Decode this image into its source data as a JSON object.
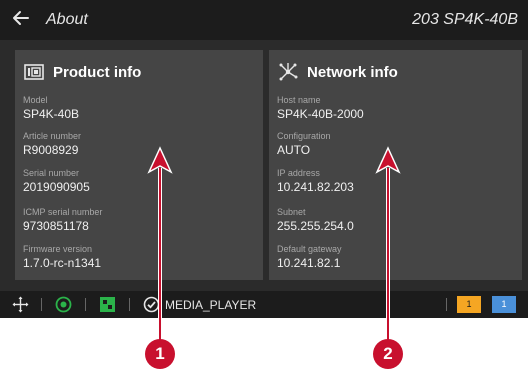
{
  "header": {
    "title": "About",
    "device_id": "203 SP4K-40B"
  },
  "product_info": {
    "title": "Product info",
    "fields": [
      {
        "label": "Model",
        "value": "SP4K-40B"
      },
      {
        "label": "Article number",
        "value": "R9008929"
      },
      {
        "label": "Serial number",
        "value": "2019090905"
      },
      {
        "label": "ICMP serial number",
        "value": "9730851178"
      },
      {
        "label": "Firmware version",
        "value": "1.7.0-rc-n1341"
      }
    ]
  },
  "network_info": {
    "title": "Network info",
    "fields": [
      {
        "label": "Host name",
        "value": "SP4K-40B-2000"
      },
      {
        "label": "Configuration",
        "value": "AUTO"
      },
      {
        "label": "IP address",
        "value": "10.241.82.203"
      },
      {
        "label": "Subnet",
        "value": "255.255.254.0"
      },
      {
        "label": "Default gateway",
        "value": "10.241.82.1"
      }
    ]
  },
  "status_bar": {
    "media_label": "MEDIA_PLAYER",
    "indicator_orange": "1",
    "indicator_blue": "1",
    "icons": [
      "joystick-icon",
      "network-status-icon",
      "grid-icon",
      "media-player-icon"
    ]
  },
  "callouts": {
    "one": "1",
    "two": "2"
  },
  "colors": {
    "callout_red": "#c8102e",
    "indicator_orange": "#f5a623",
    "indicator_blue": "#4a90d9",
    "status_green": "#2bb34a"
  }
}
